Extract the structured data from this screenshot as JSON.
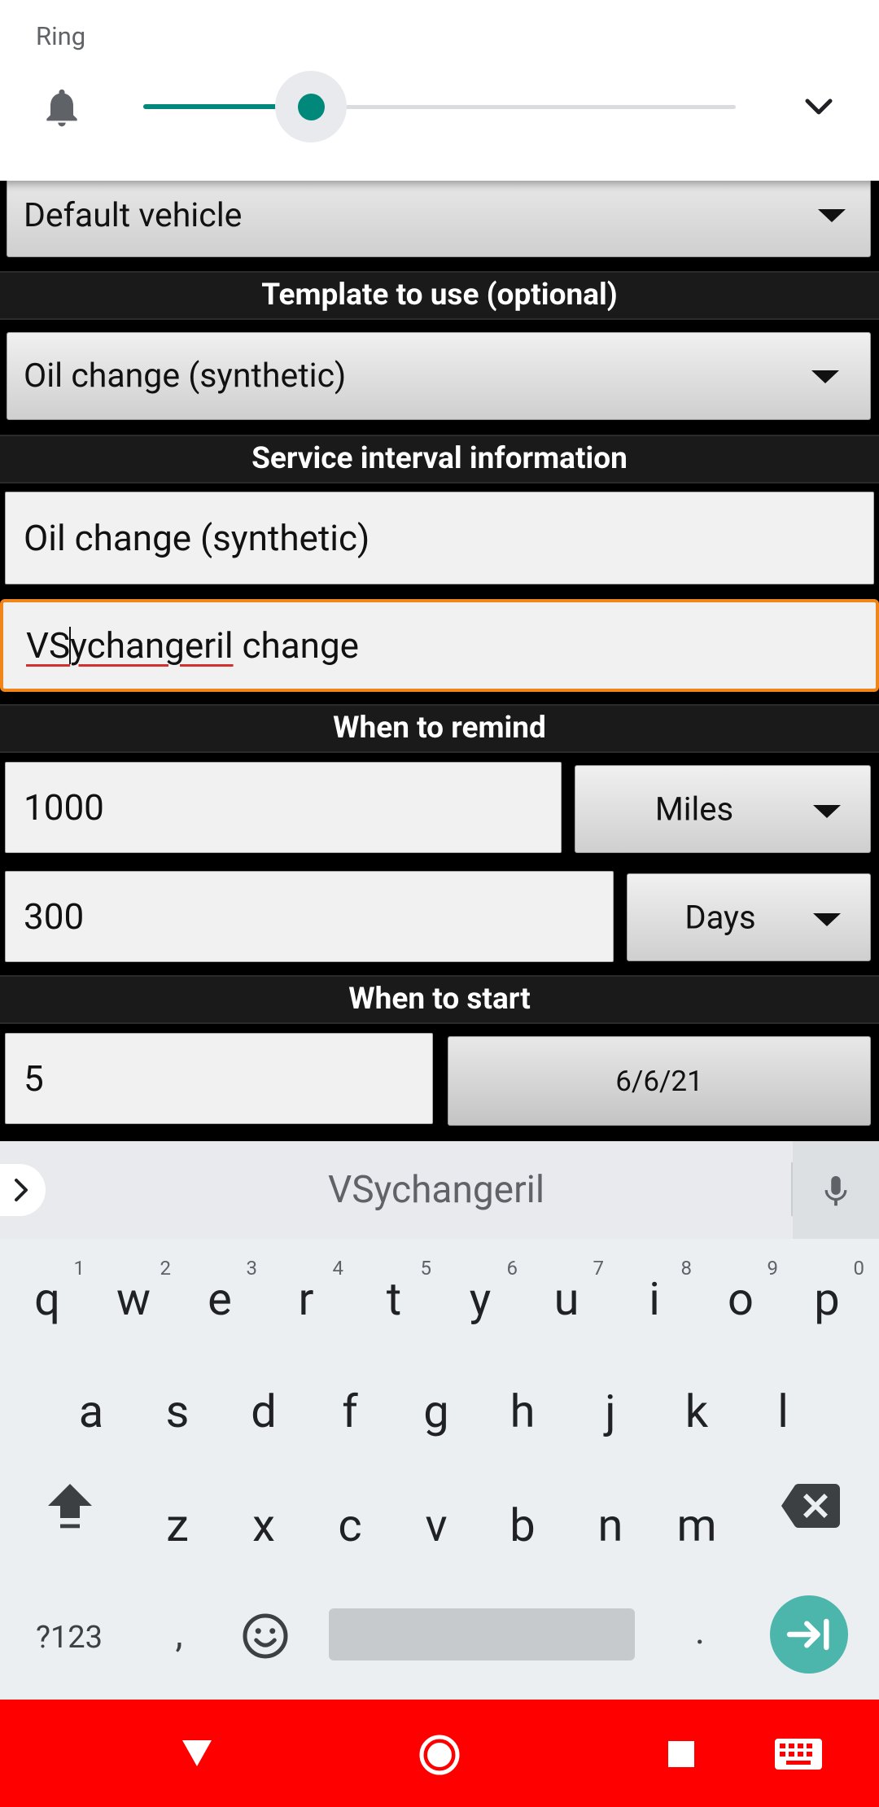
{
  "volume_panel": {
    "title": "Ring",
    "level": 0.28
  },
  "form": {
    "vehicle_select": "Default vehicle",
    "template_header": "Template to use (optional)",
    "template_select": "Oil change (synthetic)",
    "interval_header": "Service interval information",
    "name_field": "Oil change (synthetic)",
    "notes_field": {
      "before_cursor": "VS",
      "after_cursor": "ychangeril",
      "rest": " change"
    },
    "remind_header": "When to remind",
    "miles_value": "1000",
    "miles_unit": "Miles",
    "days_value": "300",
    "days_unit": "Days",
    "start_header": "When to start",
    "start_value": "5",
    "start_date": "6/6/21"
  },
  "keyboard": {
    "suggestion": "VSychangeril",
    "row1": [
      {
        "k": "q",
        "n": "1"
      },
      {
        "k": "w",
        "n": "2"
      },
      {
        "k": "e",
        "n": "3"
      },
      {
        "k": "r",
        "n": "4"
      },
      {
        "k": "t",
        "n": "5"
      },
      {
        "k": "y",
        "n": "6"
      },
      {
        "k": "u",
        "n": "7"
      },
      {
        "k": "i",
        "n": "8"
      },
      {
        "k": "o",
        "n": "9"
      },
      {
        "k": "p",
        "n": "0"
      }
    ],
    "row2": [
      "a",
      "s",
      "d",
      "f",
      "g",
      "h",
      "j",
      "k",
      "l"
    ],
    "row3": [
      "z",
      "x",
      "c",
      "v",
      "b",
      "n",
      "m"
    ],
    "symbols_label": "?123",
    "comma": ",",
    "period": "."
  },
  "colors": {
    "accent_teal": "#00897b",
    "focus_orange": "#f0861a",
    "nav_red": "#fe0000",
    "enter_teal": "#4db6ac"
  }
}
